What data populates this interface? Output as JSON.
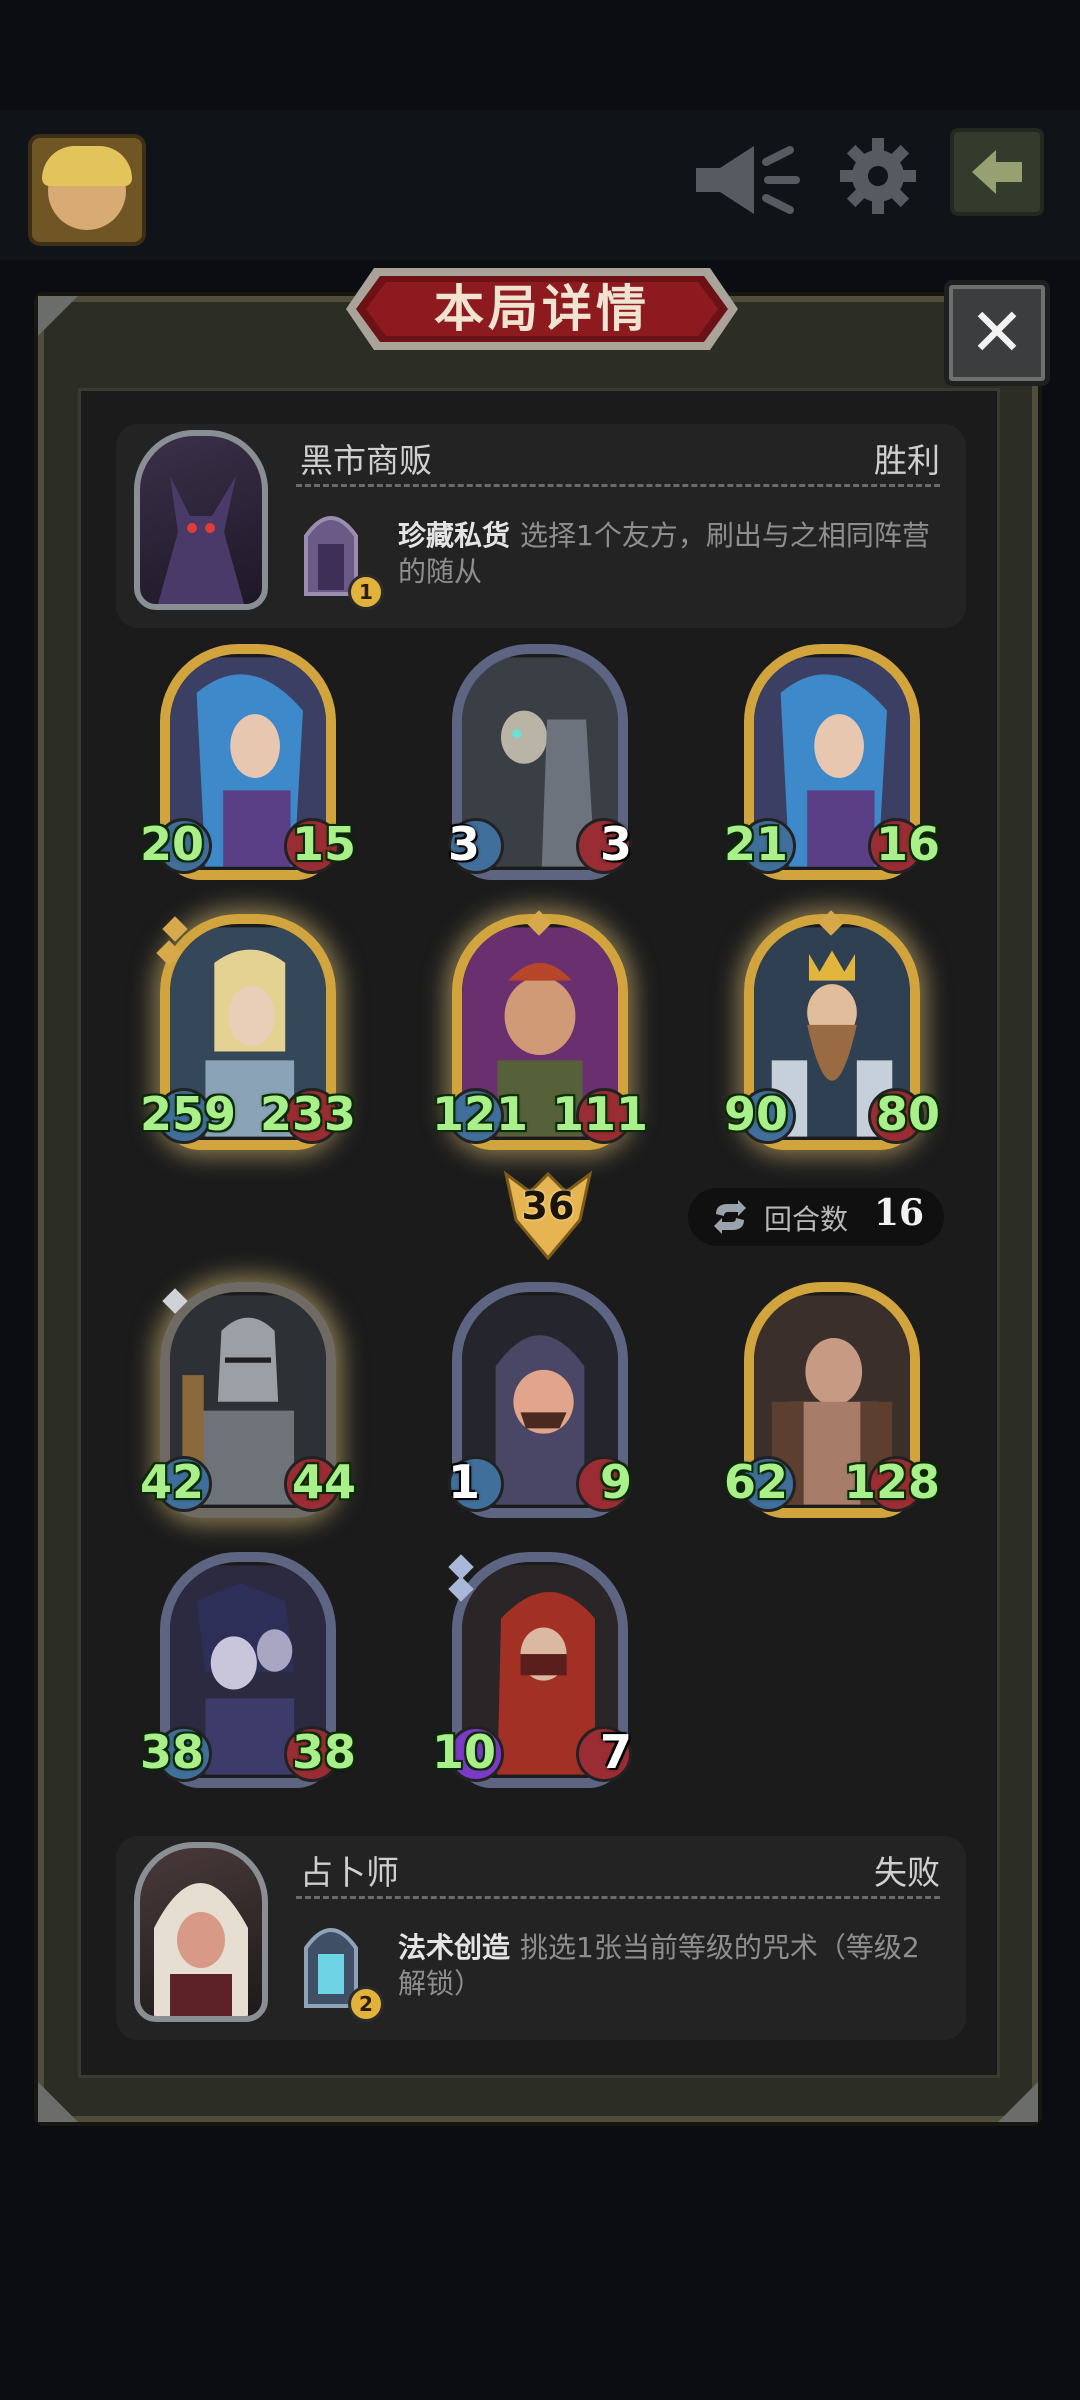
{
  "modal": {
    "title": "本局详情",
    "close_label": "✕"
  },
  "top_hero": {
    "name": "黑市商贩",
    "result": "胜利",
    "power_name": "珍藏私货",
    "power_desc": "选择1个友方，刷出与之相同阵营的随从",
    "power_level": "1"
  },
  "top_board": [
    {
      "atk": "20",
      "hp": "15",
      "frame": "gold"
    },
    {
      "atk": "3",
      "hp": "3",
      "frame": "silver"
    },
    {
      "atk": "21",
      "hp": "16",
      "frame": "gold"
    },
    {
      "atk": "259",
      "hp": "233",
      "frame": "gold"
    },
    {
      "atk": "121",
      "hp": "111",
      "frame": "gold"
    },
    {
      "atk": "90",
      "hp": "80",
      "frame": "gold"
    }
  ],
  "tier": "36",
  "round": {
    "label": "回合数",
    "value": "16"
  },
  "bottom_board": [
    {
      "atk": "42",
      "hp": "44",
      "frame": "gold"
    },
    {
      "atk": "1",
      "hp": "9",
      "frame": "silver"
    },
    {
      "atk": "62",
      "hp": "128",
      "frame": "gold"
    },
    {
      "atk": "38",
      "hp": "38",
      "frame": "silver"
    },
    {
      "atk": "10",
      "hp": "7",
      "frame": "silver"
    }
  ],
  "bottom_hero": {
    "name": "占卜师",
    "result": "失败",
    "power_name": "法术创造",
    "power_desc": "挑选1张当前等级的咒术（等级2解锁）",
    "power_level": "2"
  }
}
